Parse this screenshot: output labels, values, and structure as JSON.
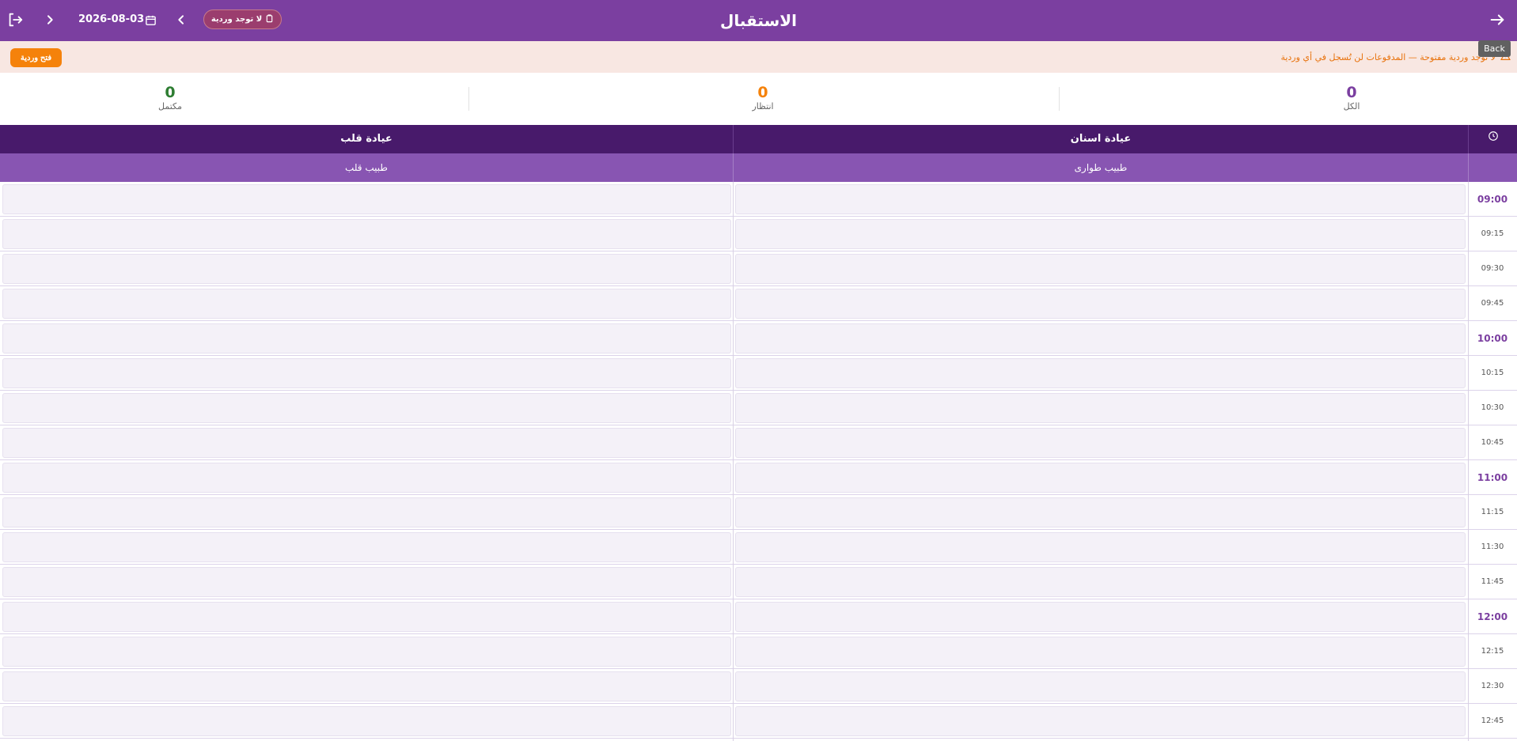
{
  "header": {
    "title": "الاستقبال",
    "date": "2026-08-03",
    "shift_status": "لا توجد وردية",
    "back_tooltip": "Back",
    "icons": {
      "back": "arrow-right-icon",
      "logout": "logout-icon",
      "next_day": "chevron-right-icon",
      "prev_day": "chevron-left-icon",
      "calendar": "calendar-icon",
      "shift": "clipboard-icon"
    }
  },
  "banner": {
    "message": "لا توجد وردية مفتوحة — المدفوعات لن تُسجل في أي وردية",
    "open_shift_label": "فتح وردية"
  },
  "stats": [
    {
      "label": "الكل",
      "value": "0",
      "color": "#7b3fa0"
    },
    {
      "label": "انتظار",
      "value": "0",
      "color": "#f5820b"
    },
    {
      "label": "مكتمل",
      "value": "0",
      "color": "#2e7d32"
    }
  ],
  "schedule": {
    "clinics": [
      {
        "name": "عيادة اسنان",
        "doctor": "طبيب طوارى"
      },
      {
        "name": "عيادة قلب",
        "doctor": "طبيب قلب"
      }
    ],
    "times": [
      {
        "label": "09:00",
        "hour": true
      },
      {
        "label": "09:15",
        "hour": false
      },
      {
        "label": "09:30",
        "hour": false
      },
      {
        "label": "09:45",
        "hour": false
      },
      {
        "label": "10:00",
        "hour": true
      },
      {
        "label": "10:15",
        "hour": false
      },
      {
        "label": "10:30",
        "hour": false
      },
      {
        "label": "10:45",
        "hour": false
      },
      {
        "label": "11:00",
        "hour": true
      },
      {
        "label": "11:15",
        "hour": false
      },
      {
        "label": "11:30",
        "hour": false
      },
      {
        "label": "11:45",
        "hour": false
      },
      {
        "label": "12:00",
        "hour": true
      },
      {
        "label": "12:15",
        "hour": false
      },
      {
        "label": "12:30",
        "hour": false
      },
      {
        "label": "12:45",
        "hour": false
      }
    ]
  },
  "colors": {
    "appbar": "#7b3fa0",
    "clinic_header": "#481a6b",
    "doctor_header": "#8855b2",
    "banner_bg": "#f8e7e2",
    "warning": "#f5820b"
  }
}
